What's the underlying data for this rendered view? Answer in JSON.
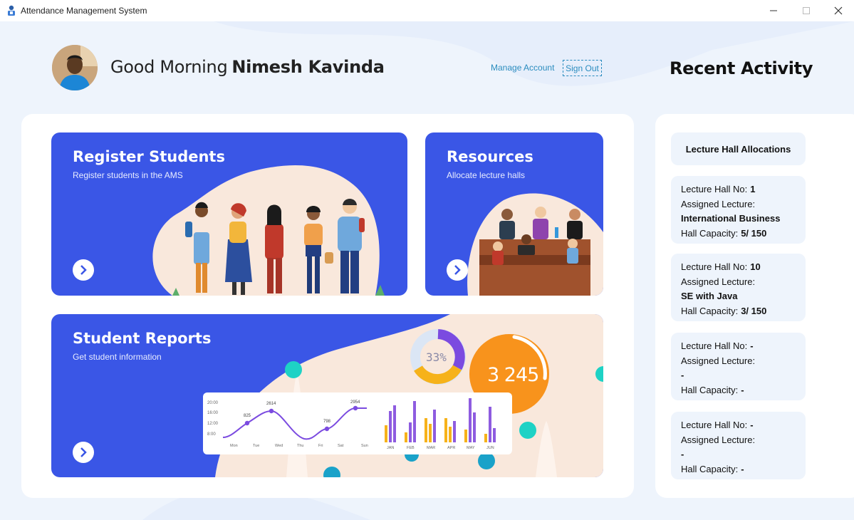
{
  "window": {
    "title": "Attendance Management System"
  },
  "header": {
    "greeting": "Good Morning",
    "user_name": "Nimesh Kavinda",
    "manage_account": "Manage Account",
    "sign_out": "Sign Out",
    "recent_activity_title": "Recent Activity"
  },
  "cards": {
    "register": {
      "title": "Register Students",
      "subtitle": "Register students in the AMS"
    },
    "resources": {
      "title": "Resources",
      "subtitle": "Allocate lecture halls"
    },
    "reports": {
      "title": "Student Reports",
      "subtitle": "Get student information",
      "donut_label": "33%",
      "gauge_label": "3 245",
      "line_chart": {
        "y_ticks": [
          "20:00",
          "16:00",
          "12:00",
          "8:00"
        ],
        "x_labels": [
          "Mon",
          "Tue",
          "Wed",
          "Thu",
          "Fri",
          "Sat",
          "Sun"
        ],
        "point_labels": [
          "825",
          "2614",
          "798",
          "2954"
        ]
      },
      "bar_chart": {
        "x_labels": [
          "JAN",
          "FEB",
          "MAR",
          "APR",
          "MAY",
          "JUN"
        ]
      }
    }
  },
  "activity": {
    "section_label": "Lecture Hall Allocations",
    "hall_no_label": "Lecture Hall No:",
    "assigned_label": "Assigned Lecture:",
    "capacity_label": "Hall Capacity:",
    "items": [
      {
        "hall_no": "1",
        "lecture": "International Business",
        "capacity": "5/ 150"
      },
      {
        "hall_no": "10",
        "lecture": "SE with Java",
        "capacity": "3/ 150"
      },
      {
        "hall_no": "-",
        "lecture": "-",
        "capacity": "-"
      },
      {
        "hall_no": "-",
        "lecture": "-",
        "capacity": "-"
      }
    ]
  },
  "colors": {
    "card_blue": "#3a56e6",
    "accent_link": "#2a8cbf",
    "panel_bg": "#eef4fc",
    "peach": "#f9e8dc"
  }
}
